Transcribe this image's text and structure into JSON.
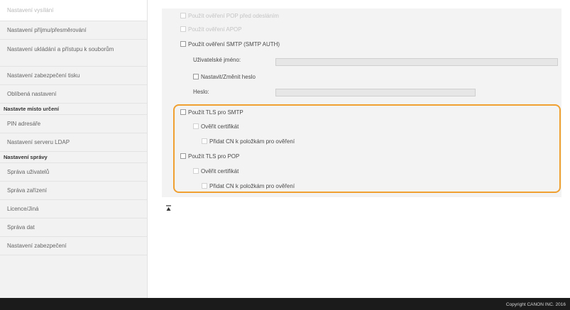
{
  "sidebar": {
    "items": [
      {
        "label": "Nastavení vysílání"
      },
      {
        "label": "Nastavení příjmu/přesměrování"
      },
      {
        "label": "Nastavení ukládání a přístupu k souborům"
      },
      {
        "label": "Nastavení zabezpečení tisku"
      },
      {
        "label": "Oblíbená nastavení"
      }
    ],
    "heading1": "Nastavte místo určení",
    "items2": [
      {
        "label": "PIN adresáře"
      },
      {
        "label": "Nastavení serveru LDAP"
      }
    ],
    "heading2": "Nastavení správy",
    "items3": [
      {
        "label": "Správa uživatelů"
      },
      {
        "label": "Správa zařízení"
      },
      {
        "label": "Licence/Jiná"
      },
      {
        "label": "Správa dat"
      },
      {
        "label": "Nastavení zabezpečení"
      }
    ]
  },
  "form": {
    "pop_before_send": "Použít ověření POP před odesláním",
    "apop": "Použít ověření APOP",
    "smtp_auth": "Použít ověření SMTP (SMTP AUTH)",
    "username_label": "Uživatelské jméno:",
    "set_change_password": "Nastavit/Změnit heslo",
    "password_label": "Heslo:",
    "tls_smtp": "Použít TLS pro SMTP",
    "verify_cert_1": "Ověřit certifikát",
    "add_cn_1": "Přidat CN k položkám pro ověření",
    "tls_pop": "Použít TLS pro POP",
    "verify_cert_2": "Ověřit certifikát",
    "add_cn_2": "Přidat CN k položkám pro ověření"
  },
  "footer": {
    "copyright": "Copyright CANON INC. 2016"
  },
  "colors": {
    "highlight": "#f0a030",
    "footer_bg": "#1b1b1b"
  },
  "icons": {
    "collapse": "collapse-arrow-icon"
  }
}
